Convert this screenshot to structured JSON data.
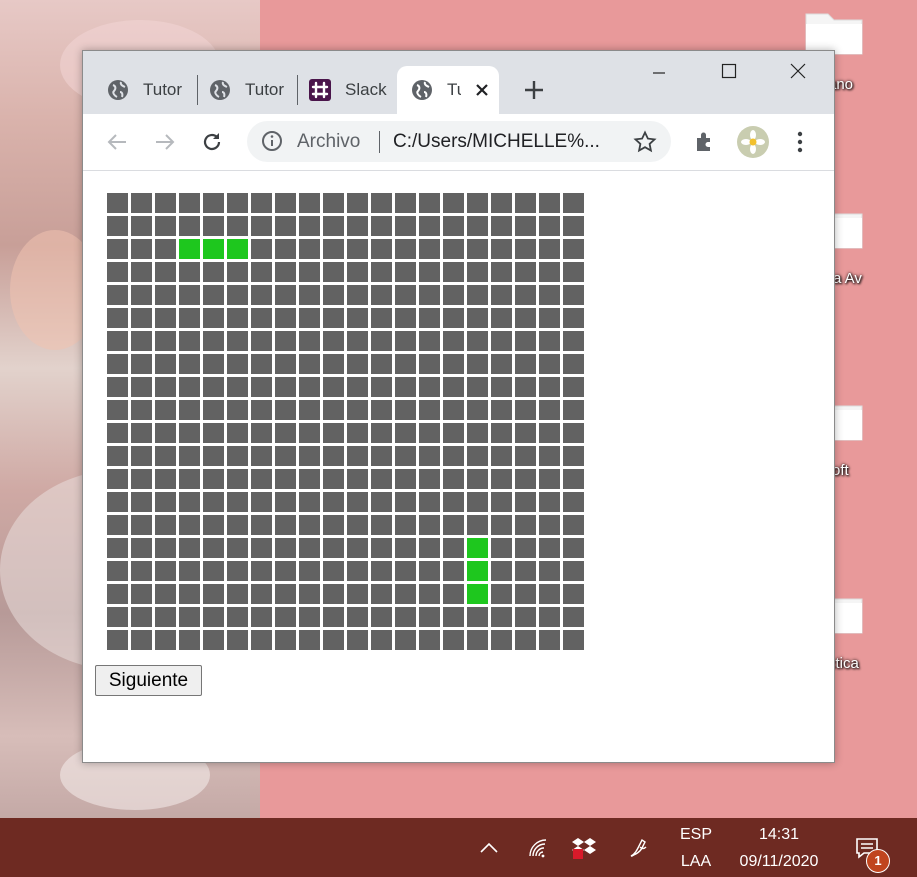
{
  "desktop": {
    "icons": [
      {
        "label": "ano"
      },
      {
        "label": "ra Av"
      },
      {
        "label": "oft"
      },
      {
        "label": "ctica"
      }
    ]
  },
  "browser": {
    "tabs": [
      {
        "title": "Tutor",
        "icon": "globe-icon"
      },
      {
        "title": "Tutor",
        "icon": "globe-icon"
      },
      {
        "title": "Slack",
        "icon": "slack-icon"
      },
      {
        "title": "Tu",
        "icon": "globe-icon",
        "active": true
      }
    ],
    "address": {
      "scheme": "Archivo",
      "url": "C:/Users/MICHELLE%..."
    }
  },
  "page": {
    "board": {
      "rows": 20,
      "cols": 20,
      "cell_color": "#626262",
      "snake_color": "#1ec71e",
      "snake_cells": [
        [
          2,
          3
        ],
        [
          2,
          4
        ],
        [
          2,
          5
        ],
        [
          15,
          15
        ],
        [
          16,
          15
        ],
        [
          17,
          15
        ]
      ]
    },
    "button_label": "Siguiente"
  },
  "taskbar": {
    "language": "ESP",
    "layout": "LAA",
    "time": "14:31",
    "date": "09/11/2020",
    "notifications": "1"
  }
}
